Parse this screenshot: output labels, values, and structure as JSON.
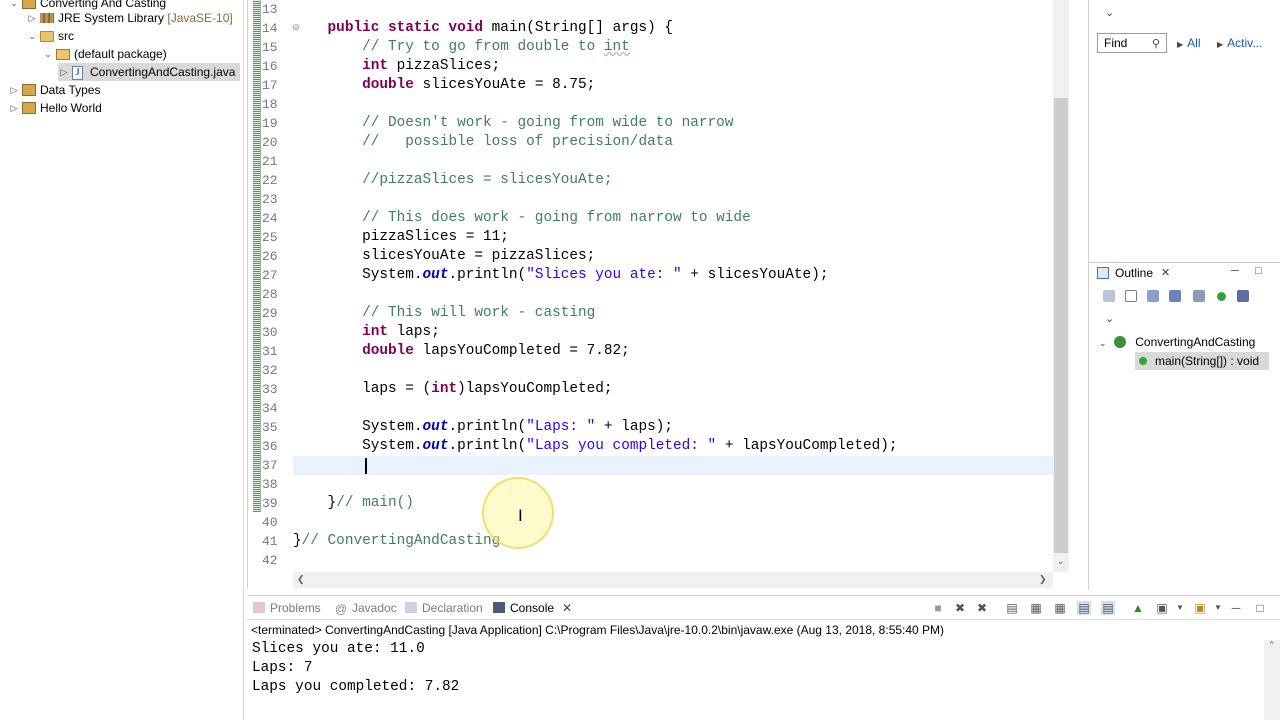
{
  "package_explorer": {
    "items": [
      {
        "label": "Converting And Casting",
        "decoration": ""
      },
      {
        "label": "JRE System Library",
        "decoration": "[JavaSE-10]"
      },
      {
        "label": "src",
        "decoration": ""
      },
      {
        "label": "(default package)",
        "decoration": ""
      },
      {
        "label": "ConvertingAndCasting.java",
        "decoration": ""
      },
      {
        "label": "Data Types",
        "decoration": ""
      },
      {
        "label": "Hello World",
        "decoration": ""
      }
    ]
  },
  "editor": {
    "line_numbers": [
      "13",
      "14",
      "15",
      "16",
      "17",
      "18",
      "19",
      "20",
      "21",
      "22",
      "23",
      "24",
      "25",
      "26",
      "27",
      "28",
      "29",
      "30",
      "31",
      "32",
      "33",
      "34",
      "35",
      "36",
      "37",
      "38",
      "39",
      "40",
      "41",
      "42"
    ],
    "current_line": "37",
    "lines": {
      "l14": {
        "indent": "    ",
        "k1": "public",
        "k2": "static",
        "k3": "void",
        "rest": " main(String[] args) {"
      },
      "l15": {
        "indent": "        ",
        "comment": "// Try to go from double to ",
        "err": "int"
      },
      "l16": {
        "indent": "        ",
        "kw": "int",
        "rest": " pizzaSlices;"
      },
      "l17": {
        "indent": "        ",
        "kw": "double",
        "rest": " slicesYouAte = 8.75;"
      },
      "l19": {
        "indent": "        ",
        "comment": "// Doesn't work - going from wide to narrow"
      },
      "l20": {
        "indent": "        ",
        "comment": "//   possible loss of precision/data"
      },
      "l22": {
        "indent": "        ",
        "comment": "//pizzaSlices = slicesYouAte;"
      },
      "l24": {
        "indent": "        ",
        "comment": "// This does work - going from narrow to wide"
      },
      "l25": {
        "indent": "        ",
        "text": "pizzaSlices = 11;"
      },
      "l26": {
        "indent": "        ",
        "text": "slicesYouAte = pizzaSlices;"
      },
      "l27": {
        "indent": "        ",
        "pre": "System.",
        "fld": "out",
        "mid": ".println(",
        "str": "\"Slices you ate: \"",
        "post": " + slicesYouAte);"
      },
      "l29": {
        "indent": "        ",
        "comment": "// This will work - casting"
      },
      "l30": {
        "indent": "        ",
        "kw": "int",
        "rest": " laps;"
      },
      "l31": {
        "indent": "        ",
        "kw": "double",
        "rest": " lapsYouCompleted = 7.82;"
      },
      "l33": {
        "indent": "        ",
        "pre": "laps = (",
        "kw": "int",
        "post": ")lapsYouCompleted;"
      },
      "l35": {
        "indent": "        ",
        "pre": "System.",
        "fld": "out",
        "mid": ".println(",
        "str": "\"Laps: \"",
        "post": " + laps);"
      },
      "l36": {
        "indent": "        ",
        "pre": "System.",
        "fld": "out",
        "mid": ".println(",
        "str": "\"Laps you completed: \"",
        "post": " + lapsYouCompleted);"
      },
      "l39": {
        "indent": "    ",
        "pre": "}",
        "comment": "// main()"
      },
      "l41": {
        "pre": "}",
        "comment": "// ConvertingAndCasting"
      }
    }
  },
  "right_panel": {
    "find_placeholder": "Find",
    "all_label": "All",
    "activate_label": "Activ..."
  },
  "outline": {
    "tab_label": "Outline",
    "class_name": "ConvertingAndCasting",
    "method_name": "main(String[]) : void"
  },
  "console": {
    "tabs": [
      "Problems",
      "Javadoc",
      "Declaration",
      "Console"
    ],
    "active_tab": "Console",
    "terminated_text": "<terminated> ConvertingAndCasting [Java Application] C:\\Program Files\\Java\\jre-10.0.2\\bin\\javaw.exe (Aug 13, 2018, 8:55:40 PM)",
    "output": [
      "Slices you ate: 11.0",
      "Laps: 7",
      "Laps you completed: 7.82"
    ]
  },
  "colors": {
    "keyword": "#7f0055",
    "comment": "#3f7f5f",
    "string": "#2a00ff",
    "field": "#0000c0",
    "current_line": "#e8f2fe"
  }
}
